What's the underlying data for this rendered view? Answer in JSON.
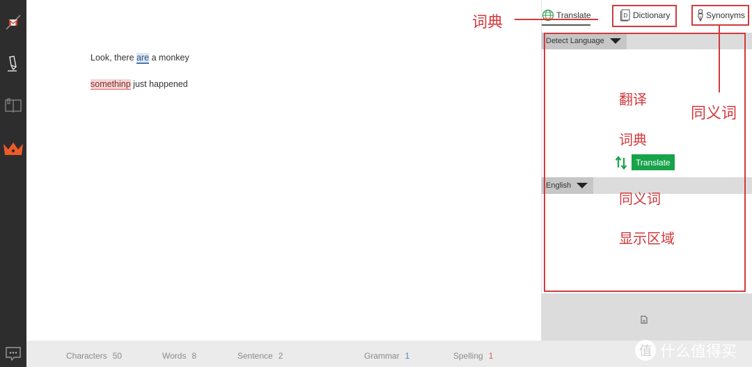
{
  "sidebar": {
    "items": [
      {
        "name": "gmail-collapse-icon"
      },
      {
        "name": "pen-icon"
      },
      {
        "name": "book-icon"
      },
      {
        "name": "crown-icon"
      }
    ],
    "bottom_item": {
      "name": "chat-icon"
    },
    "accent_color": "#f05a28"
  },
  "editor": {
    "line1": {
      "before": "Look, there ",
      "grammar_word": "are",
      "after": " a monkey"
    },
    "line2": {
      "spelling_word": "somethinp",
      "after": " just happened"
    }
  },
  "statusbar": {
    "characters": {
      "label": "Characters",
      "value": "50"
    },
    "words": {
      "label": "Words",
      "value": "8"
    },
    "sentence": {
      "label": "Sentence",
      "value": "2"
    },
    "grammar": {
      "label": "Grammar",
      "value": "1"
    },
    "spelling": {
      "label": "Spelling",
      "value": "1"
    }
  },
  "panel": {
    "tabs": {
      "translate": "Translate",
      "dictionary": "Dictionary",
      "synonyms": "Synonyms"
    },
    "active_tab": "translate",
    "source_language": "Detect Language",
    "target_language": "English",
    "translate_button": "Translate",
    "translate_color": "#17a34a"
  },
  "annotations": {
    "dictionary": "词典",
    "synonyms": "同义词",
    "area_line1": "翻译",
    "area_line2": "词典",
    "area_line3": "同义词",
    "area_line4": "显示区域",
    "color": "#d2393c"
  },
  "watermark": {
    "logo": "值",
    "text": "什么值得买"
  }
}
